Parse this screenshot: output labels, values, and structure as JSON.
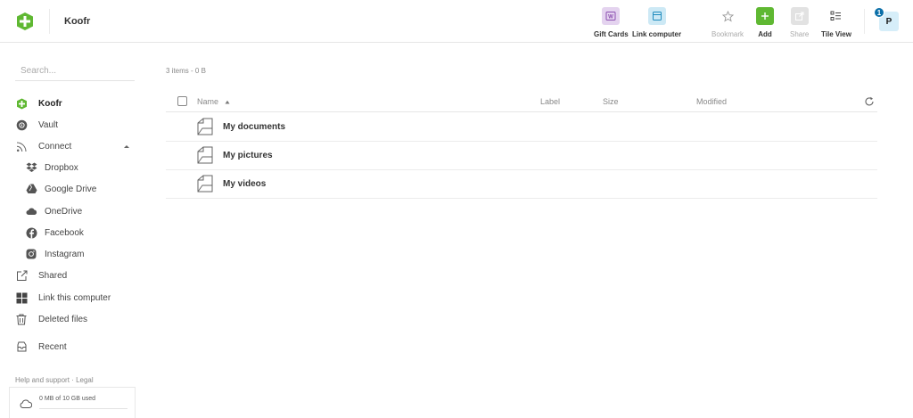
{
  "header": {
    "app_title": "Koofr",
    "toolbar": [
      {
        "key": "gift-cards",
        "label": "Gift Cards",
        "icon": "gift-card-icon"
      },
      {
        "key": "link-computer",
        "label": "Link computer",
        "icon": "computer-icon"
      },
      {
        "key": "bookmark",
        "label": "Bookmark",
        "icon": "star-icon",
        "disabled": true
      },
      {
        "key": "add",
        "label": "Add",
        "icon": "plus-icon"
      },
      {
        "key": "share",
        "label": "Share",
        "icon": "share-icon",
        "disabled": true
      },
      {
        "key": "tile-view",
        "label": "Tile View",
        "icon": "tile-view-icon"
      }
    ],
    "notification_count": "1",
    "avatar_initial": "P"
  },
  "sidebar": {
    "search_placeholder": "Search...",
    "items": [
      {
        "label": "Koofr",
        "icon": "koofr-icon",
        "active": true
      },
      {
        "label": "Vault",
        "icon": "vault-icon"
      },
      {
        "label": "Connect",
        "icon": "connect-icon",
        "expanded": true
      },
      {
        "label": "Dropbox",
        "icon": "dropbox-icon",
        "sub": true
      },
      {
        "label": "Google Drive",
        "icon": "google-drive-icon",
        "sub": true
      },
      {
        "label": "OneDrive",
        "icon": "onedrive-icon",
        "sub": true
      },
      {
        "label": "Facebook",
        "icon": "facebook-icon",
        "sub": true
      },
      {
        "label": "Instagram",
        "icon": "instagram-icon",
        "sub": true
      },
      {
        "label": "Shared",
        "icon": "shared-icon"
      },
      {
        "label": "Link this computer",
        "icon": "windows-icon"
      },
      {
        "label": "Deleted files",
        "icon": "trash-icon"
      },
      {
        "label": "Recent",
        "icon": "recent-icon"
      }
    ],
    "help_label": "Help and support",
    "help_separator": "·",
    "legal_label": "Legal",
    "storage_text": "0 MB of 10 GB used"
  },
  "main": {
    "summary": "3 items - 0 B",
    "columns": {
      "name": "Name",
      "label": "Label",
      "size": "Size",
      "modified": "Modified"
    },
    "rows": [
      {
        "name": "My documents"
      },
      {
        "name": "My pictures"
      },
      {
        "name": "My videos"
      }
    ]
  },
  "colors": {
    "brand_green": "#5fb832",
    "add_green": "#5fb832",
    "gift_purple": "#e4d3ef",
    "link_blue": "#cde9f5",
    "badge_blue": "#0a6fa8"
  }
}
